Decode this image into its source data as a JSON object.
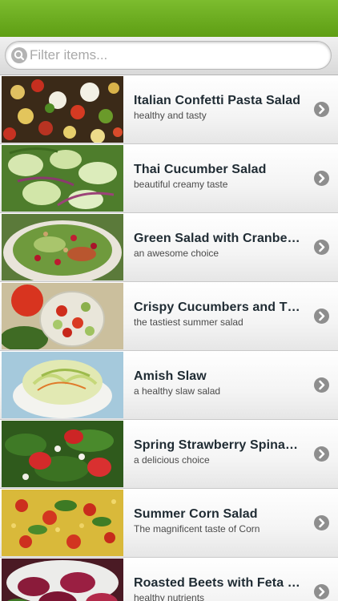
{
  "app": {
    "accent_color": "#6aac1f"
  },
  "search": {
    "placeholder": "Filter items...",
    "value": ""
  },
  "list": {
    "items": [
      {
        "title": "Italian Confetti Pasta Salad",
        "subtitle": "healthy and tasty",
        "image": "pasta-salad"
      },
      {
        "title": "Thai Cucumber Salad",
        "subtitle": "beautiful creamy taste",
        "image": "cucumber-salad"
      },
      {
        "title": "Green Salad with Cranbe…",
        "subtitle": "an awesome choice",
        "image": "green-salad"
      },
      {
        "title": "Crispy Cucumbers and T…",
        "subtitle": "the tastiest summer salad",
        "image": "cucumber-tomato"
      },
      {
        "title": "Amish Slaw",
        "subtitle": "a healthy slaw salad",
        "image": "slaw"
      },
      {
        "title": "Spring Strawberry Spina…",
        "subtitle": "a delicious choice",
        "image": "strawberry-spinach"
      },
      {
        "title": "Summer Corn Salad",
        "subtitle": "The magnificent taste of Corn",
        "image": "corn-salad"
      },
      {
        "title": "Roasted Beets with Feta …",
        "subtitle": "healthy nutrients",
        "image": "beet-salad"
      }
    ],
    "row_icon": "chevron-right-icon"
  }
}
